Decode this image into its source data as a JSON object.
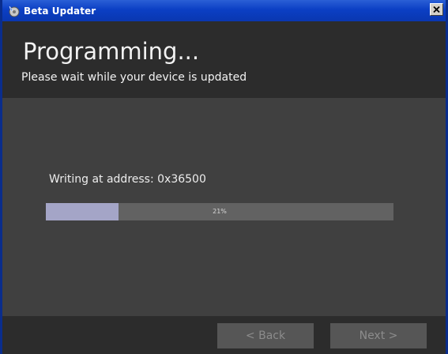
{
  "window": {
    "title": "Beta Updater",
    "close_icon": "close-icon",
    "app_icon": "updater-app-icon"
  },
  "header": {
    "title": "Programming...",
    "subtitle": "Please wait while your device is updated"
  },
  "main": {
    "status": "Writing at address: 0x36500",
    "progress": {
      "percent": 21,
      "label": "21%"
    }
  },
  "footer": {
    "back_label": "< Back",
    "next_label": "Next >",
    "buttons_enabled": false
  },
  "colors": {
    "title_bar": "#0b3fc4",
    "header_bg": "#2c2c2c",
    "body_bg": "#404040",
    "progress_fill": "#a4a5c7",
    "progress_track": "#626262"
  }
}
